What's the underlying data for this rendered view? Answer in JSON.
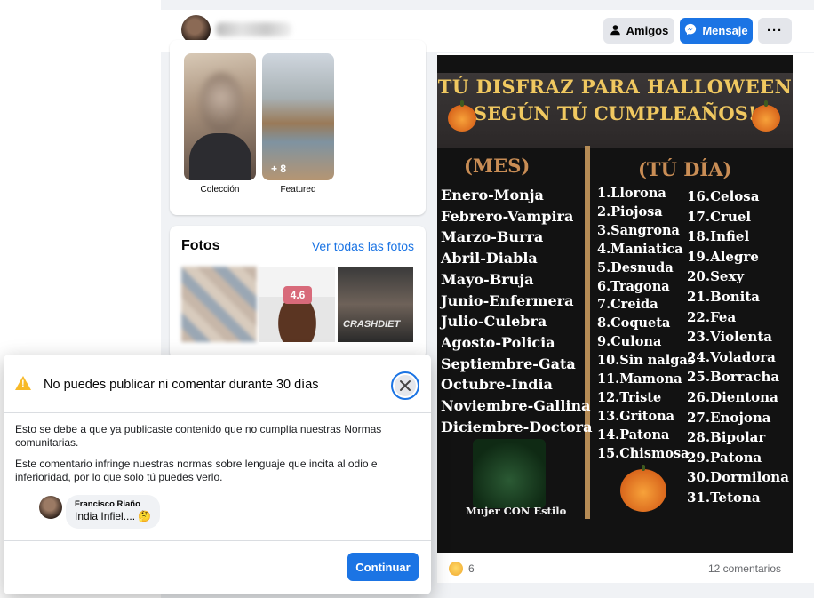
{
  "header": {
    "friends_button": "Amigos",
    "message_button": "Mensaje",
    "more_button": "···"
  },
  "featured": {
    "items": [
      {
        "caption": "Colección"
      },
      {
        "caption": "Featured",
        "overlay": "+ 8"
      }
    ]
  },
  "photos": {
    "title": "Fotos",
    "see_all": "Ver todas las fotos",
    "items": [
      {
        "label": ""
      },
      {
        "label": "4.6"
      },
      {
        "label": "CRASHDIET"
      }
    ]
  },
  "post": {
    "image_text": {
      "line1": "TÚ DISFRAZ PARA HALLOWEEN",
      "line2": "SEGÚN TÚ CUMPLEAÑOS!",
      "month_header": "(MES)",
      "day_header": "(TÚ DÍA)",
      "months": [
        "Enero-Monja",
        "Febrero-Vampira",
        "Marzo-Burra",
        "Abril-Diabla",
        "Mayo-Bruja",
        "Junio-Enfermera",
        "Julio-Culebra",
        "Agosto-Policia",
        "Septiembre-Gata",
        "Octubre-India",
        "Noviembre-Gallina",
        "Diciembre-Doctora"
      ],
      "days_col1": [
        "1.Llorona",
        "2.Piojosa",
        "3.Sangrona",
        "4.Maniatica",
        "5.Desnuda",
        "6.Tragona",
        "7.Creida",
        "8.Coqueta",
        "9.Culona",
        "10.Sin nalgas",
        "11.Mamona",
        "12.Triste",
        "13.Gritona",
        "14.Patona",
        "15.Chismosa"
      ],
      "days_col2": [
        "16.Celosa",
        "17.Cruel",
        "18.Infiel",
        "19.Alegre",
        "20.Sexy",
        "21.Bonita",
        "22.Fea",
        "23.Violenta",
        "24.Voladora",
        "25.Borracha",
        "26.Dientona",
        "27.Enojona",
        "28.Bipolar",
        "29.Patona",
        "30.Dormilona",
        "31.Tetona"
      ],
      "watermark": "Mujer CON Estilo"
    },
    "reaction_count": "6",
    "comments": "12 comentarios"
  },
  "modal": {
    "title": "No puedes publicar ni comentar durante 30 días",
    "paragraph1": "Esto se debe a que ya publicaste contenido que no cumplía nuestras Normas comunitarias.",
    "paragraph2": "Este comentario infringe nuestras normas sobre lenguaje que incita al odio e inferioridad, por lo que solo tú puedes verlo.",
    "comment_author": "Francisco Riaño",
    "comment_text": "India Infiel.... 🤔",
    "continue_button": "Continuar"
  },
  "colors": {
    "accent": "#1b74e4",
    "warning": "#f7b928"
  }
}
